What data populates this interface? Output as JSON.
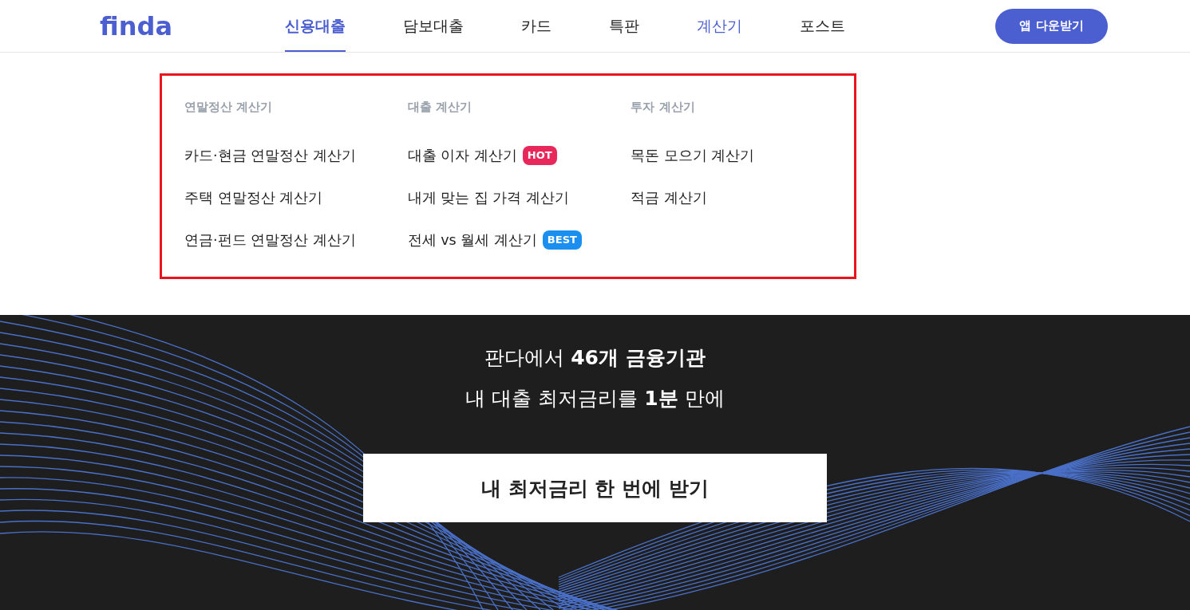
{
  "header": {
    "logo": "finda",
    "nav": [
      {
        "label": "신용대출",
        "selected": true,
        "open": false
      },
      {
        "label": "담보대출",
        "selected": false,
        "open": false
      },
      {
        "label": "카드",
        "selected": false,
        "open": false
      },
      {
        "label": "특판",
        "selected": false,
        "open": false
      },
      {
        "label": "계산기",
        "selected": false,
        "open": true
      },
      {
        "label": "포스트",
        "selected": false,
        "open": false
      }
    ],
    "download_button": "앱 다운받기"
  },
  "dropdown": {
    "highlighted": true,
    "columns": [
      {
        "heading": "연말정산 계산기",
        "items": [
          {
            "label": "카드·현금 연말정산 계산기"
          },
          {
            "label": "주택 연말정산 계산기"
          },
          {
            "label": "연금·펀드 연말정산 계산기"
          }
        ]
      },
      {
        "heading": "대출 계산기",
        "items": [
          {
            "label": "대출 이자 계산기",
            "badge": {
              "text": "HOT",
              "color": "#e8285a"
            }
          },
          {
            "label": "내게 맞는 집 가격 계산기"
          },
          {
            "label": "전세 vs 월세 계산기",
            "badge": {
              "text": "BEST",
              "color": "#1a8ff0"
            }
          }
        ]
      },
      {
        "heading": "투자 계산기",
        "items": [
          {
            "label": "목돈 모으기 계산기"
          },
          {
            "label": "적금 계산기"
          }
        ]
      }
    ]
  },
  "hero": {
    "lines": [
      "판다에서 **46개 금융기관**",
      "내 대출 최저금리를 **1분** 만에"
    ],
    "button": "내 최저금리 한 번에 받기"
  }
}
